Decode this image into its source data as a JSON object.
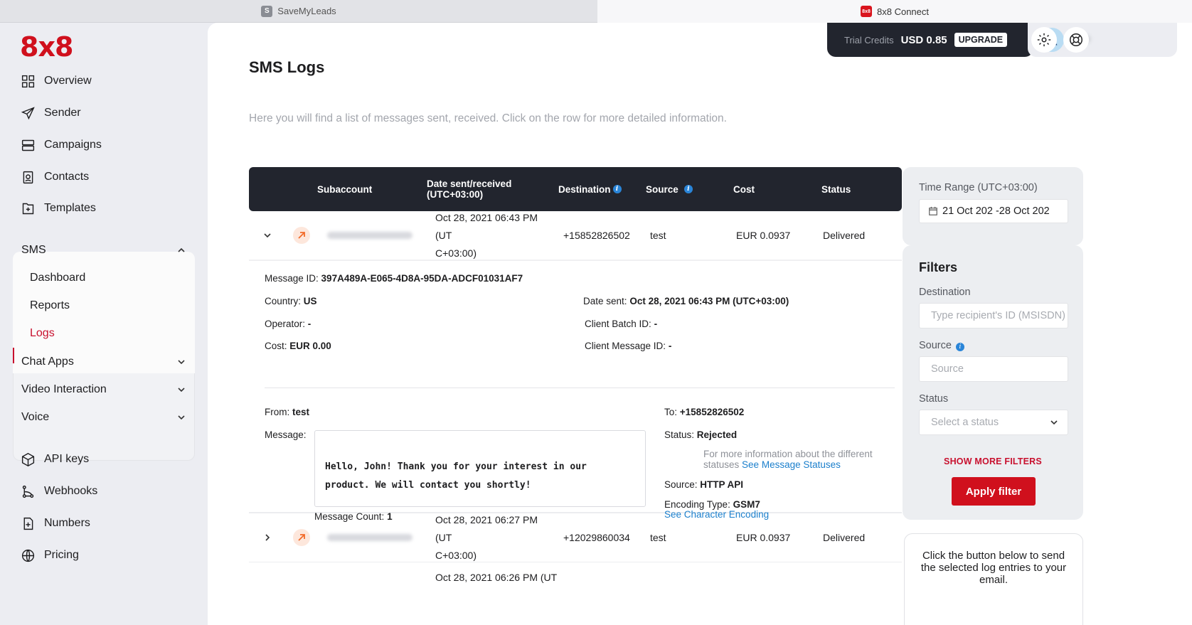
{
  "browser": {
    "tabs": [
      {
        "label": "SaveMyLeads",
        "favicon": "S"
      },
      {
        "label": "8x8 Connect",
        "favicon": "8x8"
      }
    ]
  },
  "brand": {
    "logo": "8x8",
    "accent": "#d0101d"
  },
  "sidebar": {
    "top_items": [
      {
        "label": "Overview",
        "icon": "grid-icon"
      },
      {
        "label": "Sender",
        "icon": "send-icon"
      },
      {
        "label": "Campaigns",
        "icon": "campaigns-icon"
      },
      {
        "label": "Contacts",
        "icon": "contacts-icon"
      },
      {
        "label": "Templates",
        "icon": "templates-icon"
      }
    ],
    "sms_group": {
      "label": "SMS",
      "sub_items": [
        "Dashboard",
        "Reports",
        "Logs"
      ],
      "active": "Logs"
    },
    "groups": [
      "Chat Apps",
      "Video Interaction",
      "Voice"
    ],
    "bottom_items": [
      {
        "label": "API keys",
        "icon": "cube-icon"
      },
      {
        "label": "Webhooks",
        "icon": "webhook-icon"
      },
      {
        "label": "Numbers",
        "icon": "numbers-icon"
      },
      {
        "label": "Pricing",
        "icon": "globe-icon"
      }
    ]
  },
  "account": {
    "credits_label": "Trial Credits",
    "credits_value": "USD 0.85",
    "upgrade_label": "UPGRADE"
  },
  "page": {
    "title": "SMS Logs",
    "description": "Here you will find a list of messages sent, received. Click on the row for more detailed information."
  },
  "table": {
    "headers": {
      "subaccount": "Subaccount",
      "date": "Date sent/received (UTC+03:00)",
      "destination": "Destination",
      "source": "Source",
      "cost": "Cost",
      "status": "Status"
    },
    "rows": [
      {
        "date": "Oct 28, 2021 06:43 PM (UTC+03:00)",
        "date_l1": "Oct 28, 2021 06:43 PM (UT",
        "date_l2": "C+03:00)",
        "destination": "+15852826502",
        "source": "test",
        "cost": "EUR 0.0937",
        "status": "Delivered"
      },
      {
        "date": "Oct 28, 2021 06:27 PM (UTC+03:00)",
        "date_l1": "Oct 28, 2021 06:27 PM (UT",
        "date_l2": "C+03:00)",
        "destination": "+12029860034",
        "source": "test",
        "cost": "EUR 0.0937",
        "status": "Delivered"
      },
      {
        "date_l1": "Oct 28, 2021 06:26 PM (UT"
      }
    ]
  },
  "detail": {
    "message_id_label": "Message ID:",
    "message_id": "397A489A-E065-4D8A-95DA-ADCF01031AF7",
    "country_label": "Country:",
    "country": "US",
    "operator_label": "Operator:",
    "operator": "-",
    "cost_label": "Cost:",
    "cost": "EUR 0.00",
    "date_sent_label": "Date sent:",
    "date_sent": "Oct 28, 2021 06:43 PM (UTC+03:00)",
    "client_batch_label": "Client Batch ID:",
    "client_batch": "-",
    "client_msg_label": "Client Message ID:",
    "client_msg": "-",
    "from_label": "From:",
    "from": "test",
    "to_label": "To:",
    "to": "+15852826502",
    "message_label": "Message:",
    "message_l1": "Hello, John! Thank you for your interest in our",
    "message_l2": "product. We will contact you shortly!",
    "message_count_label": "Message Count:",
    "message_count": "1",
    "status_label": "Status:",
    "status": "Rejected",
    "status_info_l1": "For more information about the different",
    "status_info_l2": "statuses",
    "status_link": "See Message Statuses",
    "source_label": "Source:",
    "source": "HTTP API",
    "encoding_label": "Encoding Type:",
    "encoding": "GSM7",
    "encoding_link": "See Character Encoding"
  },
  "filters": {
    "time_range_label": "Time Range (UTC+03:00)",
    "time_range_value": "21 Oct 202 -28 Oct 202",
    "title": "Filters",
    "destination_label": "Destination",
    "destination_placeholder": "Type recipient's ID (MSISDN)",
    "source_label": "Source",
    "source_placeholder": "Source",
    "status_label": "Status",
    "status_placeholder": "Select a status",
    "show_more": "SHOW MORE FILTERS",
    "apply": "Apply filter",
    "email_text": "Click the button below to send the selected log entries to your email."
  }
}
